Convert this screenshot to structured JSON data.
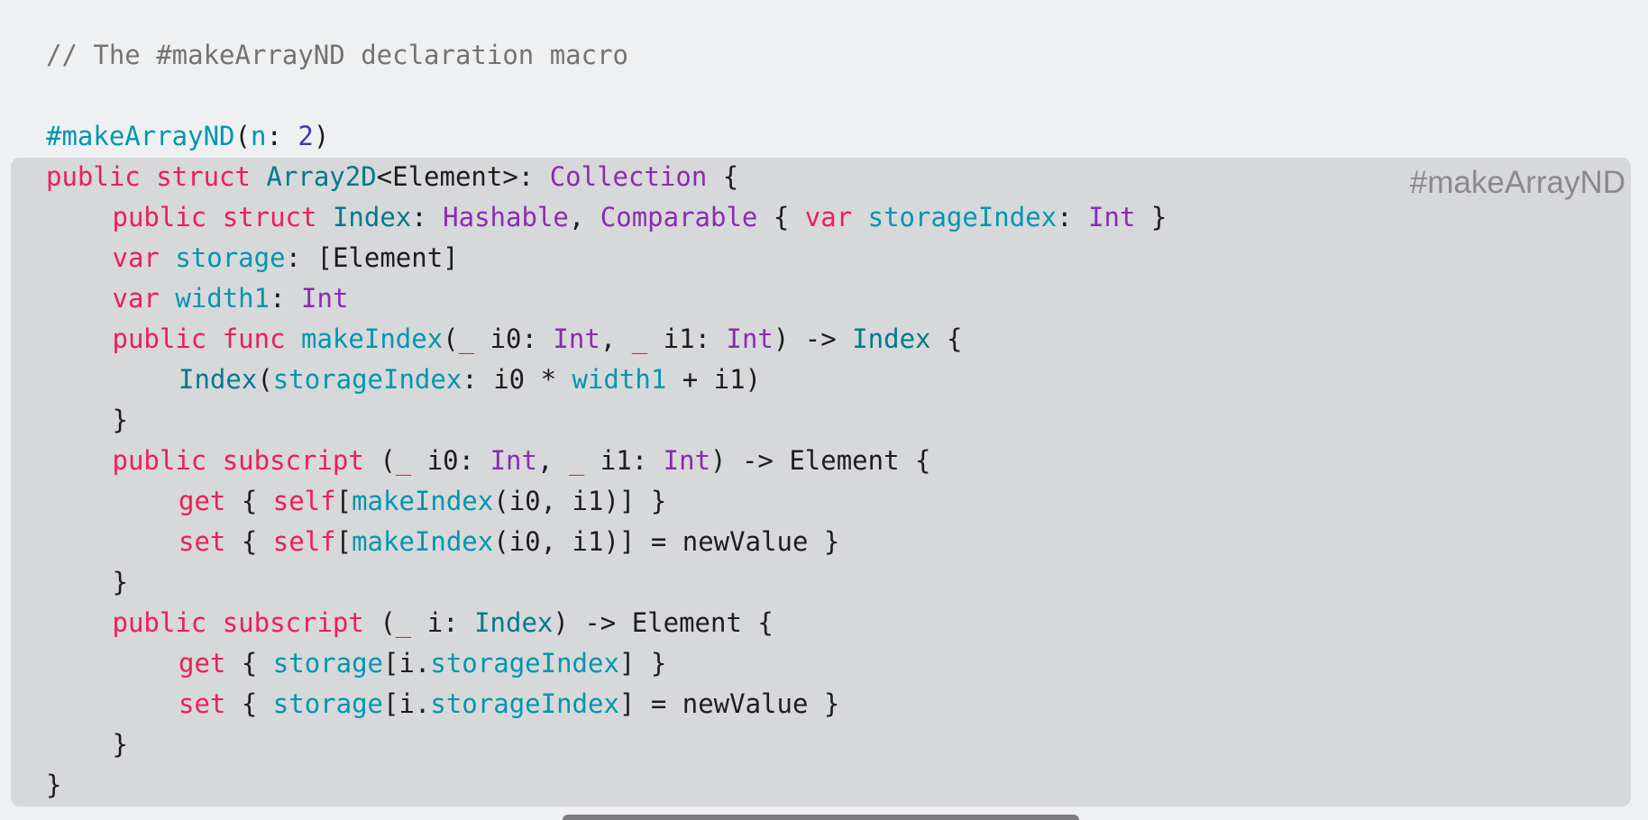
{
  "comment": "// The #makeArrayND declaration macro",
  "macro_badge": "#makeArrayND",
  "colors": {
    "keyword": "#ec1e5a",
    "type": "#007a8c",
    "protocol": "#8a2cb2",
    "identifier": "#0096b0",
    "number": "#3b3aa8",
    "plain": "#1d1d1f",
    "comment": "#737373"
  },
  "code_lines": [
    {
      "indent": 0,
      "tokens": [
        {
          "t": "#makeArrayND",
          "k": "identifier"
        },
        {
          "t": "(",
          "k": "plain"
        },
        {
          "t": "n",
          "k": "identifier"
        },
        {
          "t": ": ",
          "k": "plain"
        },
        {
          "t": "2",
          "k": "number"
        },
        {
          "t": ")",
          "k": "plain"
        }
      ]
    },
    {
      "indent": 0,
      "tokens": [
        {
          "t": "public struct ",
          "k": "keyword"
        },
        {
          "t": "Array2D",
          "k": "type"
        },
        {
          "t": "<Element>: ",
          "k": "plain"
        },
        {
          "t": "Collection",
          "k": "protocol"
        },
        {
          "t": " {",
          "k": "plain"
        }
      ]
    },
    {
      "indent": 1,
      "tokens": [
        {
          "t": "public struct ",
          "k": "keyword"
        },
        {
          "t": "Index",
          "k": "type"
        },
        {
          "t": ": ",
          "k": "plain"
        },
        {
          "t": "Hashable",
          "k": "protocol"
        },
        {
          "t": ", ",
          "k": "plain"
        },
        {
          "t": "Comparable",
          "k": "protocol"
        },
        {
          "t": " { ",
          "k": "plain"
        },
        {
          "t": "var ",
          "k": "keyword"
        },
        {
          "t": "storageIndex",
          "k": "identifier"
        },
        {
          "t": ": ",
          "k": "plain"
        },
        {
          "t": "Int",
          "k": "protocol"
        },
        {
          "t": " }",
          "k": "plain"
        }
      ]
    },
    {
      "indent": 1,
      "tokens": [
        {
          "t": "var ",
          "k": "keyword"
        },
        {
          "t": "storage",
          "k": "identifier"
        },
        {
          "t": ": [Element]",
          "k": "plain"
        }
      ]
    },
    {
      "indent": 1,
      "tokens": [
        {
          "t": "var ",
          "k": "keyword"
        },
        {
          "t": "width1",
          "k": "identifier"
        },
        {
          "t": ": ",
          "k": "plain"
        },
        {
          "t": "Int",
          "k": "protocol"
        }
      ]
    },
    {
      "indent": 1,
      "tokens": [
        {
          "t": "public func ",
          "k": "keyword"
        },
        {
          "t": "makeIndex",
          "k": "identifier"
        },
        {
          "t": "(",
          "k": "plain"
        },
        {
          "t": "_",
          "k": "keyword"
        },
        {
          "t": " i0: ",
          "k": "plain"
        },
        {
          "t": "Int",
          "k": "protocol"
        },
        {
          "t": ", ",
          "k": "plain"
        },
        {
          "t": "_",
          "k": "keyword"
        },
        {
          "t": " i1: ",
          "k": "plain"
        },
        {
          "t": "Int",
          "k": "protocol"
        },
        {
          "t": ") -> ",
          "k": "plain"
        },
        {
          "t": "Index",
          "k": "type"
        },
        {
          "t": " {",
          "k": "plain"
        }
      ]
    },
    {
      "indent": 2,
      "tokens": [
        {
          "t": "Index",
          "k": "type"
        },
        {
          "t": "(",
          "k": "plain"
        },
        {
          "t": "storageIndex",
          "k": "identifier"
        },
        {
          "t": ": i0 * ",
          "k": "plain"
        },
        {
          "t": "width1",
          "k": "identifier"
        },
        {
          "t": " + i1)",
          "k": "plain"
        }
      ]
    },
    {
      "indent": 1,
      "tokens": [
        {
          "t": "}",
          "k": "plain"
        }
      ]
    },
    {
      "indent": 1,
      "tokens": [
        {
          "t": "public subscript ",
          "k": "keyword"
        },
        {
          "t": "(",
          "k": "plain"
        },
        {
          "t": "_",
          "k": "keyword"
        },
        {
          "t": " i0: ",
          "k": "plain"
        },
        {
          "t": "Int",
          "k": "protocol"
        },
        {
          "t": ", ",
          "k": "plain"
        },
        {
          "t": "_",
          "k": "keyword"
        },
        {
          "t": " i1: ",
          "k": "plain"
        },
        {
          "t": "Int",
          "k": "protocol"
        },
        {
          "t": ") -> Element {",
          "k": "plain"
        }
      ]
    },
    {
      "indent": 2,
      "tokens": [
        {
          "t": "get",
          "k": "keyword"
        },
        {
          "t": " { ",
          "k": "plain"
        },
        {
          "t": "self",
          "k": "keyword"
        },
        {
          "t": "[",
          "k": "plain"
        },
        {
          "t": "makeIndex",
          "k": "identifier"
        },
        {
          "t": "(i0, i1)] }",
          "k": "plain"
        }
      ]
    },
    {
      "indent": 2,
      "tokens": [
        {
          "t": "set",
          "k": "keyword"
        },
        {
          "t": " { ",
          "k": "plain"
        },
        {
          "t": "self",
          "k": "keyword"
        },
        {
          "t": "[",
          "k": "plain"
        },
        {
          "t": "makeIndex",
          "k": "identifier"
        },
        {
          "t": "(i0, i1)] = newValue }",
          "k": "plain"
        }
      ]
    },
    {
      "indent": 1,
      "tokens": [
        {
          "t": "}",
          "k": "plain"
        }
      ]
    },
    {
      "indent": 1,
      "tokens": [
        {
          "t": "public subscript ",
          "k": "keyword"
        },
        {
          "t": "(",
          "k": "plain"
        },
        {
          "t": "_",
          "k": "keyword"
        },
        {
          "t": " i: ",
          "k": "plain"
        },
        {
          "t": "Index",
          "k": "type"
        },
        {
          "t": ") -> Element {",
          "k": "plain"
        }
      ]
    },
    {
      "indent": 2,
      "tokens": [
        {
          "t": "get",
          "k": "keyword"
        },
        {
          "t": " { ",
          "k": "plain"
        },
        {
          "t": "storage",
          "k": "identifier"
        },
        {
          "t": "[i.",
          "k": "plain"
        },
        {
          "t": "storageIndex",
          "k": "identifier"
        },
        {
          "t": "] }",
          "k": "plain"
        }
      ]
    },
    {
      "indent": 2,
      "tokens": [
        {
          "t": "set",
          "k": "keyword"
        },
        {
          "t": " { ",
          "k": "plain"
        },
        {
          "t": "storage",
          "k": "identifier"
        },
        {
          "t": "[i.",
          "k": "plain"
        },
        {
          "t": "storageIndex",
          "k": "identifier"
        },
        {
          "t": "] = newValue }",
          "k": "plain"
        }
      ]
    },
    {
      "indent": 1,
      "tokens": [
        {
          "t": "}",
          "k": "plain"
        }
      ]
    },
    {
      "indent": 0,
      "tokens": [
        {
          "t": "}",
          "k": "plain"
        }
      ]
    }
  ]
}
